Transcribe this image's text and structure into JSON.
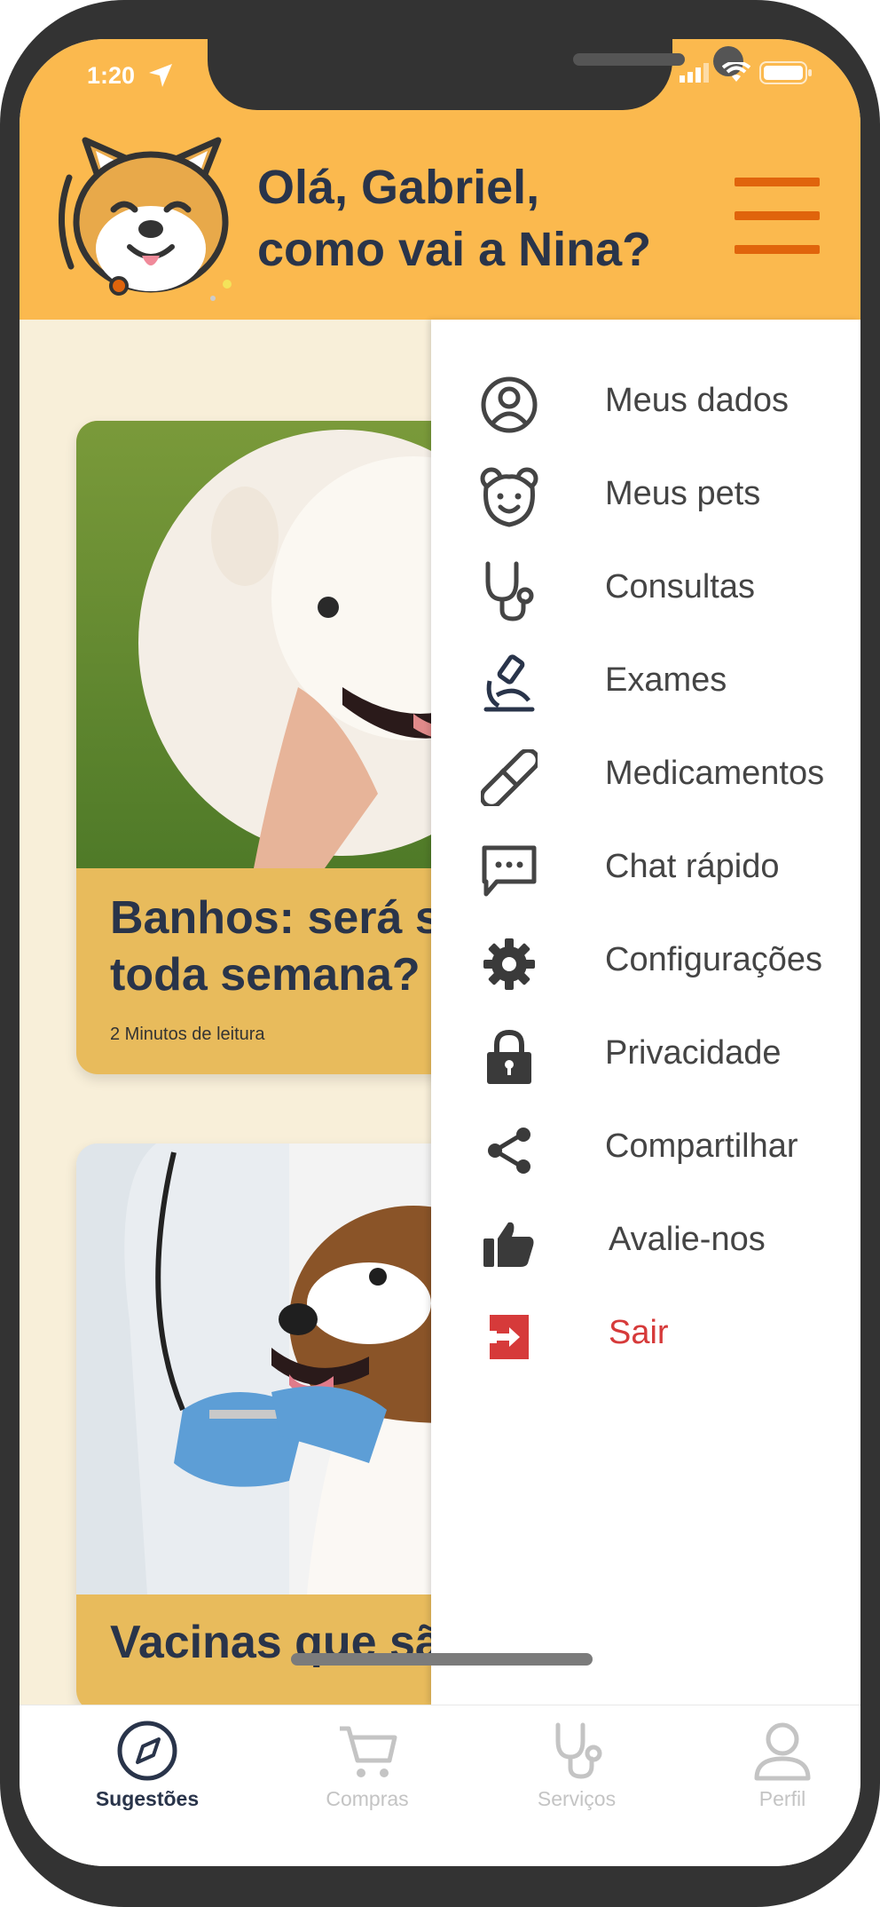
{
  "status_bar": {
    "time": "1:20"
  },
  "header": {
    "greeting": "Olá, Gabriel,\ncomo vai a Nina?",
    "menu_icon": "hamburger-icon",
    "logo_icon": "dog-logo-icon"
  },
  "cards": [
    {
      "title": "Banhos: será s\ntoda semana?",
      "meta": "2 Minutos de leitura",
      "image": "white-dog-photo"
    },
    {
      "title": "Vacinas que sã",
      "image": "beagle-vaccine-photo"
    }
  ],
  "menu": {
    "items": [
      {
        "label": "Meus dados",
        "icon": "user-circle-icon"
      },
      {
        "label": "Meus pets",
        "icon": "pet-face-icon"
      },
      {
        "label": "Consultas",
        "icon": "stethoscope-icon"
      },
      {
        "label": "Exames",
        "icon": "microscope-icon"
      },
      {
        "label": "Medicamentos",
        "icon": "pill-icon"
      },
      {
        "label": "Chat rápido",
        "icon": "chat-icon"
      },
      {
        "label": "Configurações",
        "icon": "gear-icon"
      },
      {
        "label": "Privacidade",
        "icon": "lock-icon"
      },
      {
        "label": "Compartilhar",
        "icon": "share-icon"
      },
      {
        "label": "Avalie-nos",
        "icon": "thumbs-up-icon"
      },
      {
        "label": "Sair",
        "icon": "logout-icon"
      }
    ]
  },
  "bottom_nav": {
    "items": [
      {
        "label": "Sugestões",
        "icon": "compass-icon",
        "active": true
      },
      {
        "label": "Compras",
        "icon": "cart-icon",
        "active": false
      },
      {
        "label": "Serviços",
        "icon": "stethoscope-icon",
        "active": false
      },
      {
        "label": "Perfil",
        "icon": "user-icon",
        "active": false
      }
    ]
  },
  "colors": {
    "header_bg": "#fbb94e",
    "menu_accent": "#e0640c",
    "title_text": "#29344a",
    "card_bg": "#e8bb5c",
    "logout_red": "#d63a3a"
  }
}
